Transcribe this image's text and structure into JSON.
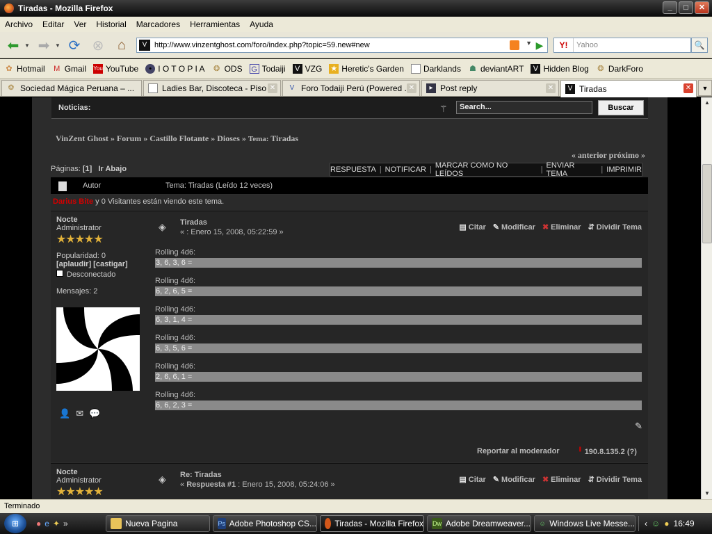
{
  "window": {
    "title": "Tiradas - Mozilla Firefox",
    "min": "_",
    "max": "□",
    "close": "✕"
  },
  "menu": [
    "Archivo",
    "Editar",
    "Ver",
    "Historial",
    "Marcadores",
    "Herramientas",
    "Ayuda"
  ],
  "nav": {
    "url": "http://www.vinzentghost.com/foro/index.php?topic=59.new#new",
    "search_placeholder": "Yahoo",
    "search_engine": "Y!"
  },
  "bookmarks": [
    {
      "label": "Hotmail",
      "icon": "butterfly-icon"
    },
    {
      "label": "Gmail",
      "icon": "mail-icon"
    },
    {
      "label": "YouTube",
      "icon": "youtube-icon"
    },
    {
      "label": "I O T O P I A",
      "icon": "circle-icon"
    },
    {
      "label": "ODS",
      "icon": "seal-icon"
    },
    {
      "label": "Todaiji",
      "icon": "g-icon"
    },
    {
      "label": "VZG",
      "icon": "vzg-icon"
    },
    {
      "label": "Heretic's Garden",
      "icon": "star-icon"
    },
    {
      "label": "Darklands",
      "icon": "page-icon"
    },
    {
      "label": "deviantART",
      "icon": "devil-icon"
    },
    {
      "label": "Hidden Blog",
      "icon": "vzg-icon"
    },
    {
      "label": "DarkForo",
      "icon": "seal-icon"
    }
  ],
  "tabs": [
    {
      "label": "Sociedad Mágica Peruana – ..."
    },
    {
      "label": "Ladies Bar, Discoteca - Piso ..."
    },
    {
      "label": "Foro Todaiji Perú (Powered ..."
    },
    {
      "label": "Post reply"
    },
    {
      "label": "Tiradas"
    }
  ],
  "forum": {
    "news_label": "Noticias:",
    "search_value": "Search...",
    "search_button": "Buscar",
    "breadcrumb": {
      "items": [
        "VinZent Ghost",
        "Forum",
        "Castillo Flotante",
        "Dioses"
      ],
      "sep": " » ",
      "topic_prefix": "Tema:",
      "topic": "Tiradas"
    },
    "prevnext": "« anterior próximo »",
    "pages_label": "Páginas:",
    "page_current": "[1]",
    "go_down": "Ir Abajo",
    "actions": [
      "RESPUESTA",
      "NOTIFICAR",
      "MARCAR COMO NO LEÍDOS",
      "ENVIAR TEMA",
      "IMPRIMIR"
    ],
    "header": {
      "author": "Autor",
      "topic": "Tema: Tiradas  (Leído 12 veces)"
    },
    "viewing": {
      "user": "Darius Bite",
      "rest": " y 0 Visitantes están viendo este tema."
    },
    "posts": [
      {
        "author": "Nocte",
        "rank": "Administrator",
        "popularity": "Popularidad: 0",
        "karma": "[aplaudir] [castigar]",
        "status": "Desconectado",
        "messages": "Mensajes: 2",
        "title": "Tiradas",
        "date_prefix": "« ",
        "date_bold": "",
        "date": ": Enero 15, 2008, 05:22:59 »",
        "rolls": [
          {
            "label": "Rolling 4d6:",
            "result": "3, 6, 3, 6 ="
          },
          {
            "label": "Rolling 4d6:",
            "result": "6, 2, 6, 5 ="
          },
          {
            "label": "Rolling 4d6:",
            "result": "6, 3, 1, 4 ="
          },
          {
            "label": "Rolling 4d6:",
            "result": "6, 3, 5, 6 ="
          },
          {
            "label": "Rolling 4d6:",
            "result": "2, 6, 6, 1 ="
          },
          {
            "label": "Rolling 4d6:",
            "result": "6, 6, 2, 3 ="
          }
        ],
        "report": "Reportar al moderador",
        "ip": "190.8.135.2 (?)"
      },
      {
        "author": "Nocte",
        "rank": "Administrator",
        "title": "Re: Tiradas",
        "date_prefix": "« ",
        "date_bold": "Respuesta #1",
        "date": " : Enero 15, 2008, 05:24:06 »"
      }
    ],
    "post_tools": [
      "Citar",
      "Modificar",
      "Eliminar",
      "Dividir Tema"
    ]
  },
  "statusbar": "Terminado",
  "taskbar": {
    "tasks": [
      "Nueva Pagina",
      "Adobe Photoshop CS...",
      "Tiradas - Mozilla Firefox",
      "Adobe Dreamweaver...",
      "Windows Live Messe..."
    ],
    "clock": "16:49"
  }
}
